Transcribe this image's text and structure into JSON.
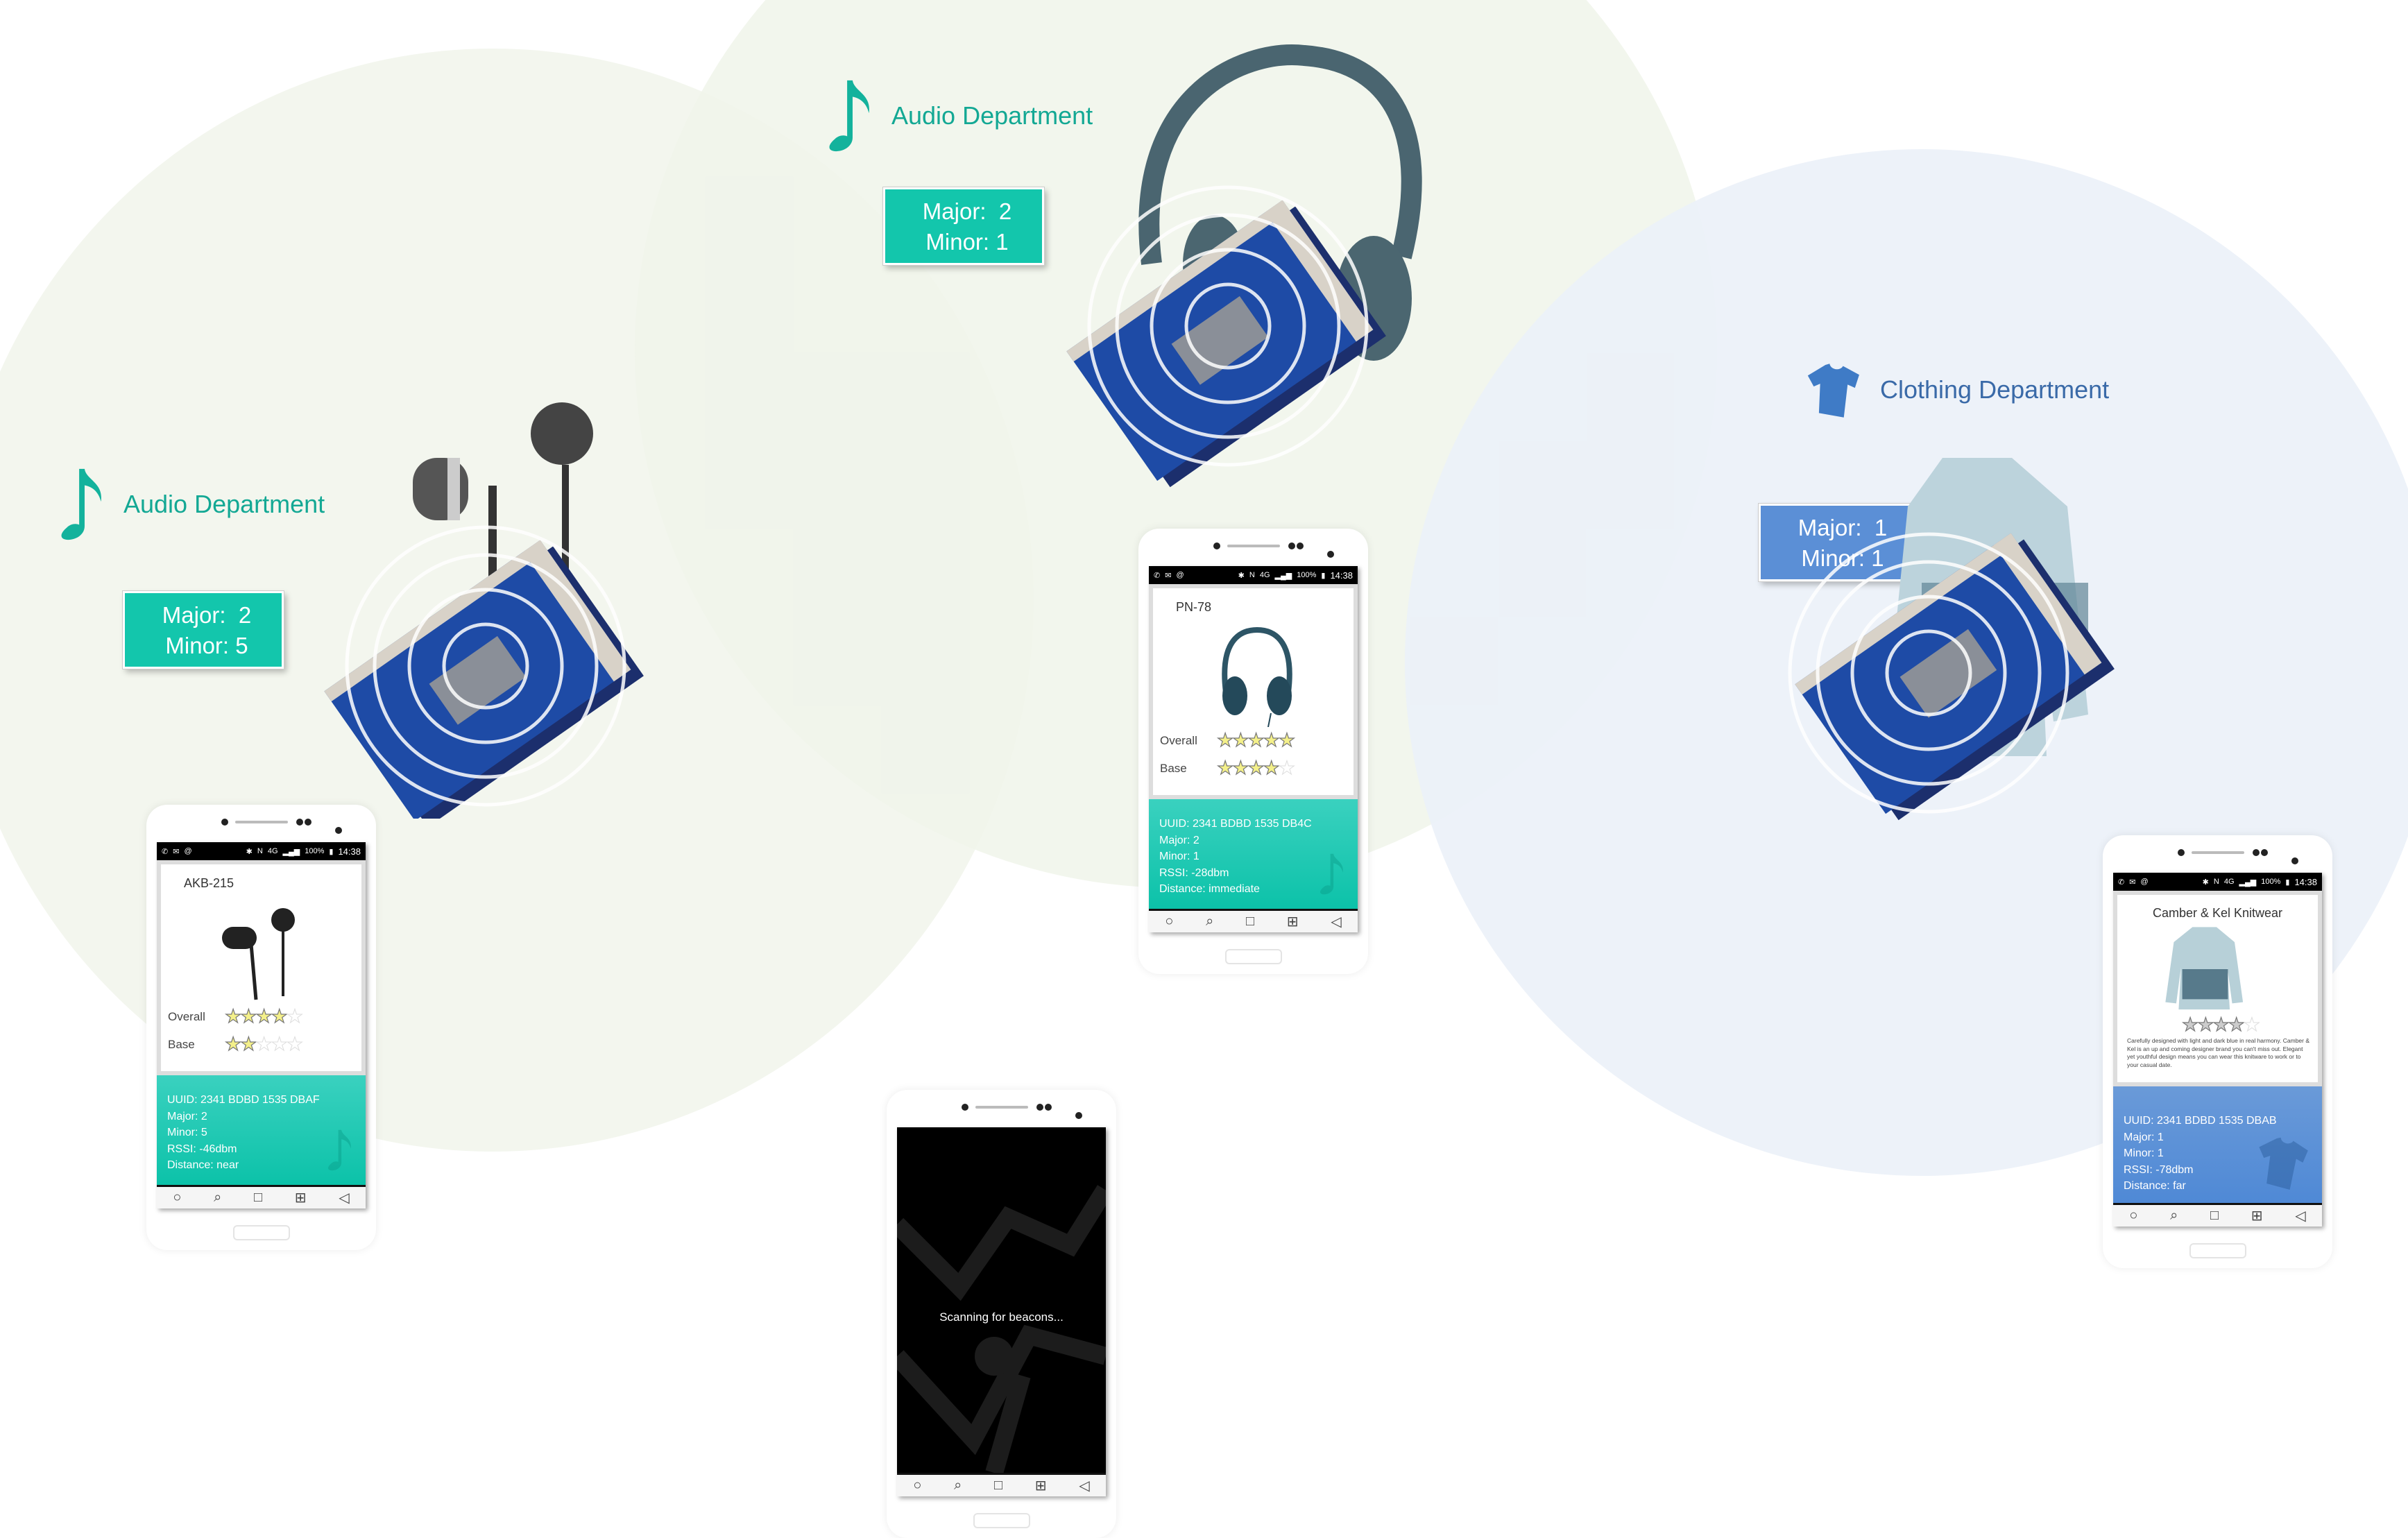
{
  "colors": {
    "teal": "#13c2a9",
    "blue": "#5b8fd6",
    "zone_green": "#f3f6ee",
    "zone_blue": "#eef2f8"
  },
  "zones": [
    {
      "label": "Audio Department",
      "icon": "music-note-icon",
      "major_label": "Major:",
      "major": "2",
      "minor_label": "Minor:",
      "minor": "5"
    },
    {
      "label": "Audio Department",
      "icon": "music-note-icon",
      "major_label": "Major:",
      "major": "2",
      "minor_label": "Minor:",
      "minor": "1"
    },
    {
      "label": "Clothing Department",
      "icon": "tshirt-icon",
      "major_label": "Major:",
      "major": "1",
      "minor_label": "Minor:",
      "minor": "1"
    }
  ],
  "status_bar": {
    "battery": "100%",
    "time": "14:38",
    "net": "4G"
  },
  "phones": [
    {
      "product": "AKB-215",
      "overall_label": "Overall",
      "overall": 4,
      "base_label": "Base",
      "base": 2,
      "uuid": "UUID: 2341 BDBD 1535 DBAF",
      "major": "Major:  2",
      "minor": "Minor: 5",
      "rssi": "RSSI:  -46dbm",
      "distance": "Distance: near"
    },
    {
      "product": "PN-78",
      "overall_label": "Overall",
      "overall": 5,
      "base_label": "Base",
      "base": 4,
      "uuid": "UUID: 2341 BDBD 1535 DB4C",
      "major": "Major:  2",
      "minor": "Minor: 1",
      "rssi": "RSSI:  -28dbm",
      "distance": "Distance: immediate"
    },
    {
      "product": "Camber & Kel Knitwear",
      "rating": 4,
      "description": "Carefully designed with light and dark blue in real harmony. Camber & Kel is an up and coming designer brand you can't miss out. Elegant yet youthful design means you can wear this knitware to work or to your casual date.",
      "uuid": "UUID: 2341 BDBD 1535 DBAB",
      "major": "Major:  1",
      "minor": "Minor: 1",
      "rssi": "RSSI:  -78dbm",
      "distance": "Distance: far"
    }
  ],
  "scanner": {
    "message": "Scanning for beacons..."
  }
}
